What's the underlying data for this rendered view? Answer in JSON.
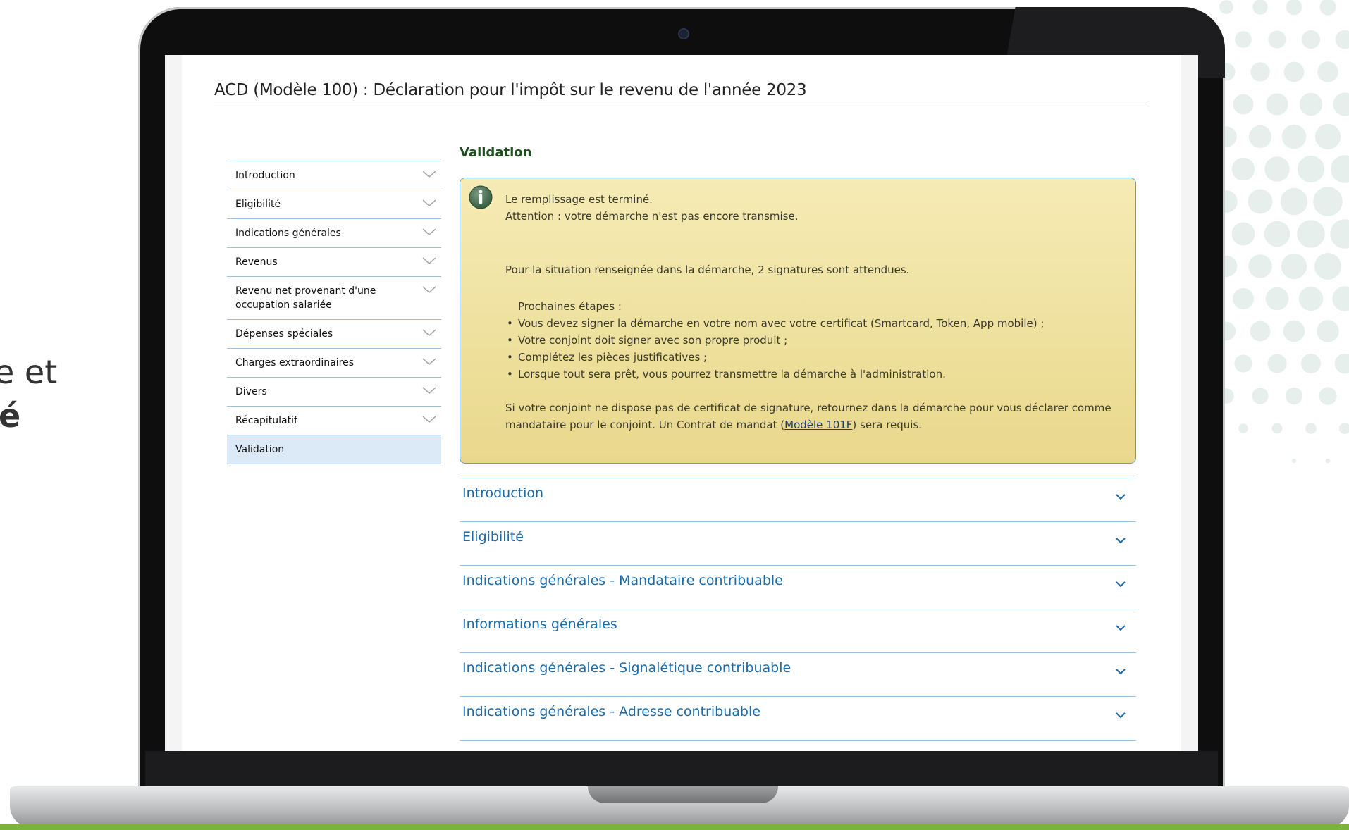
{
  "side_text": {
    "line1": "e et",
    "line2": "é"
  },
  "page": {
    "title": "ACD (Modèle 100) : Déclaration pour l'impôt sur le revenu de l'année 2023"
  },
  "sidebar": {
    "items": [
      {
        "label": "Introduction",
        "active": false
      },
      {
        "label": "Eligibilité",
        "active": false
      },
      {
        "label": "Indications générales",
        "active": false
      },
      {
        "label": "Revenus",
        "active": false
      },
      {
        "label": "Revenu net provenant d'une occupation salariée",
        "active": false
      },
      {
        "label": "Dépenses spéciales",
        "active": false
      },
      {
        "label": "Charges extraordinaires",
        "active": false
      },
      {
        "label": "Divers",
        "active": false
      },
      {
        "label": "Récapitulatif",
        "active": false
      },
      {
        "label": "Validation",
        "active": true
      }
    ]
  },
  "main": {
    "heading": "Validation",
    "info_box": {
      "line1": "Le remplissage est terminé.",
      "line2": "Attention : votre démarche n'est pas encore transmise.",
      "signatures": "Pour la situation renseignée dans la démarche, 2 signatures sont attendues.",
      "next_steps_title": "Prochaines étapes :",
      "steps": [
        "Vous devez signer la démarche en votre nom avec votre certificat (Smartcard, Token, App mobile) ;",
        "Votre conjoint doit signer avec son propre produit ;",
        "Complétez les pièces justificatives ;",
        "Lorsque tout sera prêt, vous pourrez transmettre la démarche à l'administration."
      ],
      "mandate_before": "Si votre conjoint ne dispose pas de certificat de signature, retournez dans la démarche pour vous déclarer comme mandataire pour le conjoint. Un Contrat de mandat (",
      "mandate_link": "Modèle 101F",
      "mandate_after": ") sera requis."
    },
    "accordion": [
      "Introduction",
      "Eligibilité",
      "Indications générales - Mandataire contribuable",
      "Informations générales",
      "Indications générales - Signalétique contribuable",
      "Indications générales - Adresse contribuable"
    ]
  }
}
